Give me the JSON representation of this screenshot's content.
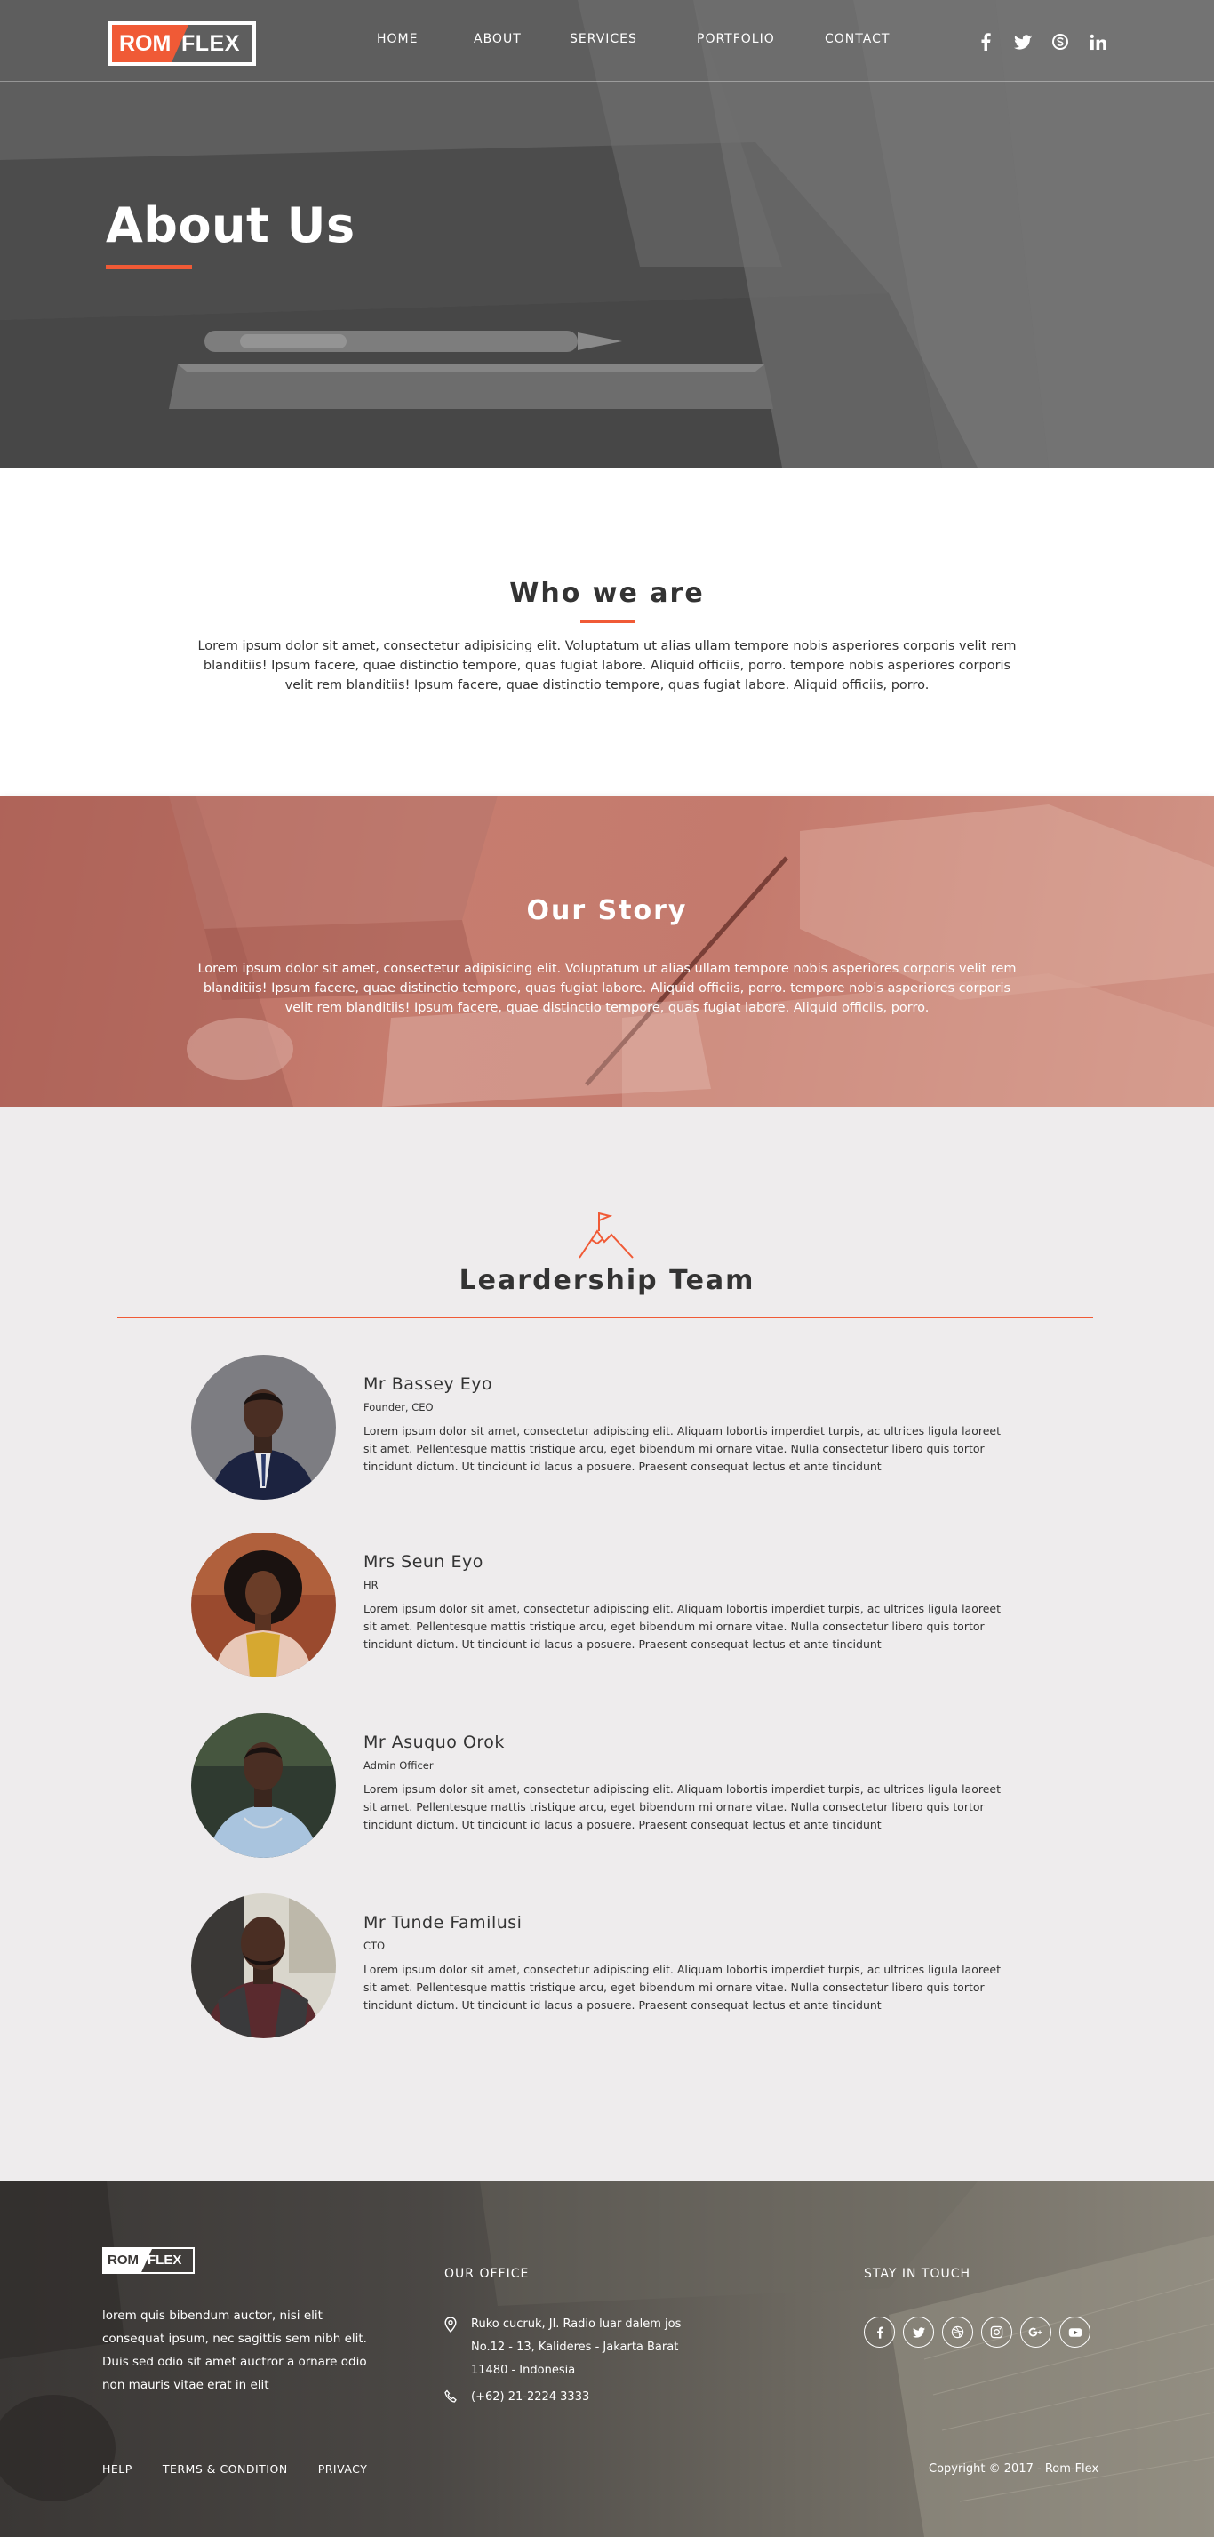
{
  "brand": {
    "logo_left": "ROM",
    "logo_right": "FLEX",
    "accent_color": "#f05a36"
  },
  "nav": {
    "items": [
      {
        "label": "HOME"
      },
      {
        "label": "ABOUT"
      },
      {
        "label": "SERVICES"
      },
      {
        "label": "PORTFOLIO"
      },
      {
        "label": "CONTACT"
      }
    ],
    "social_icons": [
      "facebook-icon",
      "twitter-icon",
      "skype-icon",
      "linkedin-icon"
    ]
  },
  "hero": {
    "title": "About Us"
  },
  "who_we_are": {
    "title": "Who we are",
    "text": "Lorem ipsum dolor sit amet, consectetur adipisicing elit. Voluptatum ut alias ullam tempore nobis asperiores corporis velit rem blanditiis! Ipsum facere, quae distinctio tempore, quas fugiat labore. Aliquid officiis, porro. tempore nobis asperiores corporis velit rem blanditiis! Ipsum facere, quae distinctio tempore, quas fugiat labore. Aliquid officiis, porro."
  },
  "our_story": {
    "title": "Our Story",
    "text": "Lorem ipsum dolor sit amet, consectetur adipisicing elit. Voluptatum ut alias ullam tempore nobis asperiores corporis velit rem blanditiis! Ipsum facere, quae distinctio tempore, quas fugiat labore. Aliquid officiis, porro. tempore nobis asperiores corporis velit rem blanditiis! Ipsum facere, quae distinctio tempore, quas fugiat labore. Aliquid officiis, porro."
  },
  "team": {
    "title": "Leardership Team",
    "members": [
      {
        "name": "Mr Bassey Eyo",
        "role": "Founder, CEO",
        "bio": "Lorem ipsum dolor sit amet, consectetur adipiscing elit. Aliquam lobortis imperdiet turpis, ac ultrices ligula laoreet sit amet. Pellentesque mattis tristique arcu, eget bibendum mi ornare vitae. Nulla consectetur libero quis tortor tincidunt dictum. Ut tincidunt id lacus a posuere. Praesent consequat lectus et ante tincidunt"
      },
      {
        "name": "Mrs Seun Eyo",
        "role": "HR",
        "bio": "Lorem ipsum dolor sit amet, consectetur adipiscing elit. Aliquam lobortis imperdiet turpis, ac ultrices ligula laoreet sit amet. Pellentesque mattis tristique arcu, eget bibendum mi ornare vitae. Nulla consectetur libero quis tortor tincidunt dictum. Ut tincidunt id lacus a posuere. Praesent consequat lectus et ante tincidunt"
      },
      {
        "name": "Mr Asuquo Orok",
        "role": "Admin Officer",
        "bio": "Lorem ipsum dolor sit amet, consectetur adipiscing elit. Aliquam lobortis imperdiet turpis, ac ultrices ligula laoreet sit amet. Pellentesque mattis tristique arcu, eget bibendum mi ornare vitae. Nulla consectetur libero quis tortor tincidunt dictum. Ut tincidunt id lacus a posuere. Praesent consequat lectus et ante tincidunt"
      },
      {
        "name": "Mr Tunde Familusi",
        "role": "CTO",
        "bio": "Lorem ipsum dolor sit amet, consectetur adipiscing elit. Aliquam lobortis imperdiet turpis, ac ultrices ligula laoreet sit amet. Pellentesque mattis tristique arcu, eget bibendum mi ornare vitae. Nulla consectetur libero quis tortor tincidunt dictum. Ut tincidunt id lacus a posuere. Praesent consequat lectus et ante tincidunt"
      }
    ]
  },
  "footer": {
    "logo_left": "ROM",
    "logo_right": "FLEX",
    "about": "lorem quis bibendum auctor, nisi elit consequat ipsum, nec sagittis sem nibh elit. Duis sed odio sit amet auctror a ornare odio non mauris vitae erat in elit",
    "office": {
      "heading": "OUR OFFICE",
      "address_line1": "Ruko cucruk, Jl. Radio luar dalem jos",
      "address_line2": "No.12 - 13, Kalideres - Jakarta Barat",
      "address_line3": "11480 - Indonesia",
      "phone": "(+62) 21-2224 3333"
    },
    "stay_in_touch": {
      "heading": "STAY IN TOUCH",
      "icons": [
        "facebook-icon",
        "twitter-icon",
        "dribbble-icon",
        "instagram-icon",
        "google-plus-icon",
        "youtube-icon"
      ]
    },
    "links": [
      {
        "label": "HELP"
      },
      {
        "label": "TERMS & CONDITION"
      },
      {
        "label": "PRIVACY"
      }
    ],
    "copyright": "Copyright © 2017 - Rom-Flex"
  }
}
